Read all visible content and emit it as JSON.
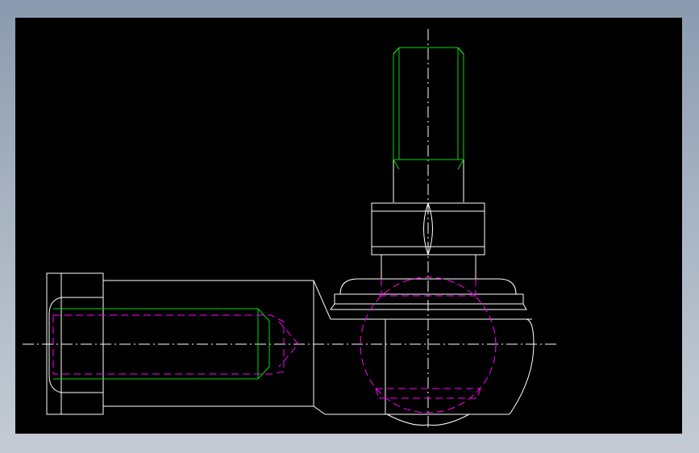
{
  "viewport": {
    "background": "#000000",
    "frame_gradient": [
      "#8a9aae",
      "#c4cbd4"
    ]
  },
  "colors": {
    "visible_edge": "#ffffff",
    "thread_line": "#00dd00",
    "hidden_line": "#ff00ff",
    "center_line": "#ffffff"
  },
  "drawing": {
    "subject": "ball-joint-rod-end",
    "views": [
      "threaded-stud",
      "hex-nut",
      "ball-socket-housing",
      "threaded-shank-with-hex-head"
    ]
  }
}
